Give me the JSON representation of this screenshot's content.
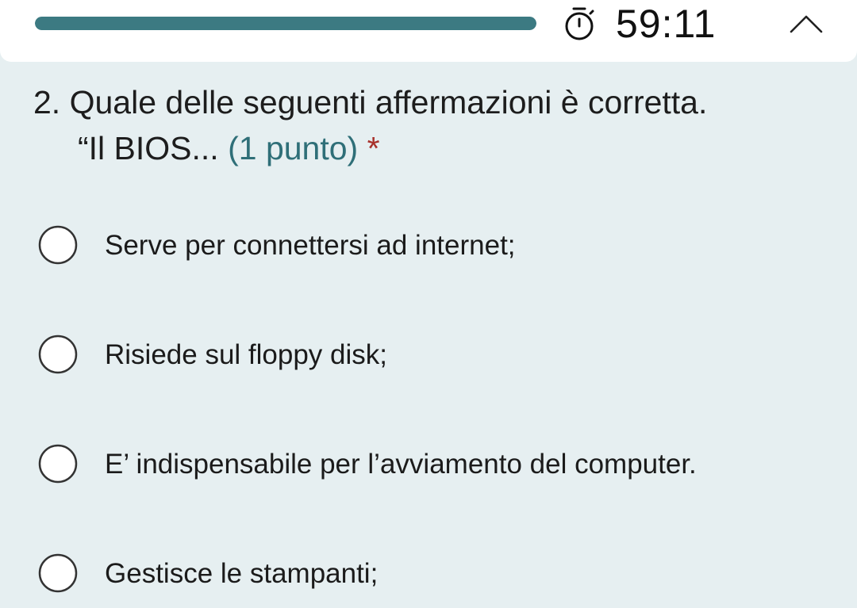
{
  "header": {
    "progress": 1.0,
    "timer": "59:11",
    "icons": {
      "timer": "stopwatch-icon",
      "collapse": "chevron-up-icon"
    },
    "colors": {
      "progress": "#3c7a82",
      "points": "#2f6f78",
      "required": "#a8312b"
    }
  },
  "question": {
    "number": "2.",
    "text_line1": "Quale delle seguenti affermazioni è corretta.",
    "text_line2": "“Il BIOS...",
    "points": "(1 punto)",
    "required_marker": "*"
  },
  "options": [
    {
      "label": "Serve per connettersi ad internet;"
    },
    {
      "label": "Risiede sul floppy disk;"
    },
    {
      "label": "E’ indispensabile per l’avviamento del computer."
    },
    {
      "label": "Gestisce le stampanti;"
    }
  ]
}
